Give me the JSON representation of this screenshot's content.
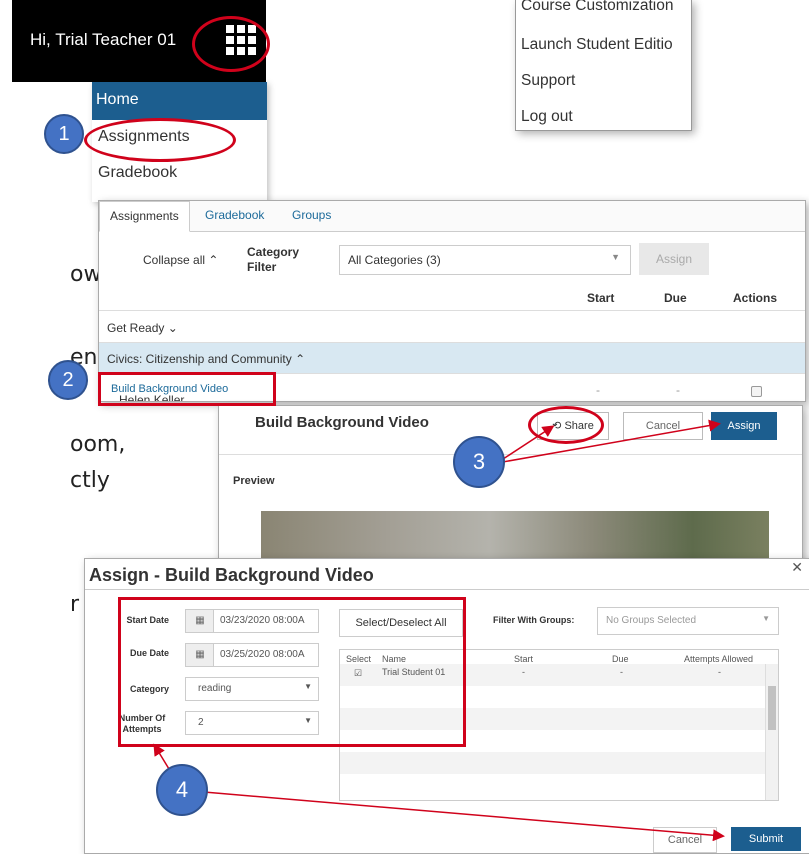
{
  "background_text": [
    "own",
    "en.",
    "oom,",
    "ctly",
    "r of"
  ],
  "header": {
    "greeting": "Hi, Trial Teacher 01"
  },
  "nav": {
    "home": "Home",
    "assignments": "Assignments",
    "gradebook": "Gradebook"
  },
  "user_menu": [
    "Course Customization",
    "Launch Student Editio",
    "Support",
    "Log out"
  ],
  "assignments_panel": {
    "tabs": [
      "Assignments",
      "Gradebook",
      "Groups"
    ],
    "collapse_all": "Collapse all",
    "category_filter_label": "Category Filter",
    "category_filter_value": "All Categories (3)",
    "assign_button": "Assign",
    "columns": {
      "start": "Start",
      "due": "Due",
      "actions": "Actions"
    },
    "get_ready": "Get Ready",
    "civics_group": "Civics: Citizenship and Community",
    "build_video": "Build Background Video",
    "dash": "-",
    "helen_keller": "Helen Keller"
  },
  "video_panel": {
    "title": "Build Background Video",
    "share": "Share",
    "cancel": "Cancel",
    "assign": "Assign",
    "preview": "Preview"
  },
  "assign_dialog": {
    "title": "Assign - Build Background Video",
    "start_date_label": "Start Date",
    "start_date": "03/23/2020 08:00A",
    "due_date_label": "Due Date",
    "due_date": "03/25/2020 08:00A",
    "category_label": "Category",
    "category": "reading",
    "attempts_label": "Number Of Attempts",
    "attempts": "2",
    "select_all": "Select/Deselect All",
    "filter_groups_label": "Filter With Groups:",
    "filter_groups_placeholder": "No Groups Selected",
    "table_headers": {
      "select": "Select",
      "name": "Name",
      "start": "Start",
      "due": "Due",
      "attempts": "Attempts Allowed"
    },
    "student": {
      "name": "Trial Student 01",
      "start": "-",
      "due": "-",
      "attempts": "-"
    },
    "cancel": "Cancel",
    "submit": "Submit"
  },
  "badges": [
    "1",
    "2",
    "3",
    "4"
  ],
  "colors": {
    "nav_blue": "#1c5e8f",
    "link_blue": "#1c6a9a",
    "highlight_row": "#d8e8f2",
    "annotation_red": "#d0021b",
    "badge_blue": "#4472c4"
  }
}
